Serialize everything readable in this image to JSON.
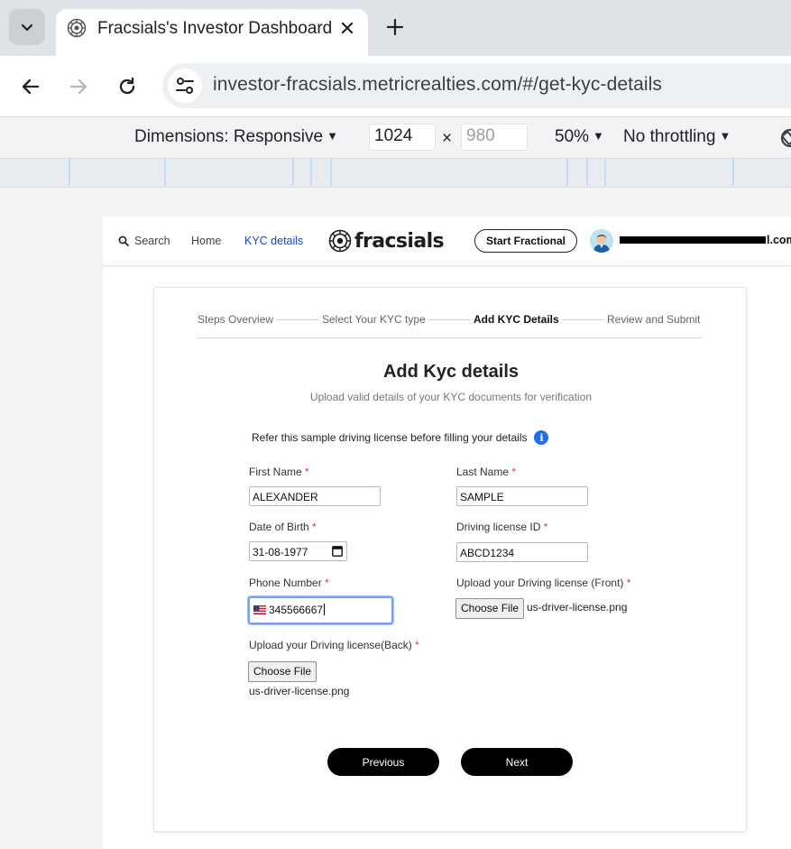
{
  "browser": {
    "tab_title": "Fracsials's Investor Dashboard",
    "url": "investor-fracsials.metricrealties.com/#/get-kyc-details"
  },
  "devtools": {
    "dimensions_label": "Dimensions: Responsive",
    "width": "1024",
    "height_placeholder": "980",
    "times": "×",
    "zoom": "50%",
    "throttling": "No throttling"
  },
  "site_header": {
    "search": "Search",
    "home": "Home",
    "kyc_details": "KYC details",
    "logo_text": "fracsials",
    "start_fractional": "Start Fractional",
    "email_suffix": "l.com"
  },
  "stepper": {
    "steps": [
      "Steps Overview",
      "Select Your KYC type",
      "Add KYC Details",
      "Review and Submit"
    ],
    "current_index": 2
  },
  "form": {
    "title": "Add Kyc details",
    "subtitle": "Upload valid details of your KYC documents for verification",
    "sample_note": "Refer this sample driving license before filling your details",
    "info_icon": "i",
    "required_mark": "*",
    "first_name_label": "First Name",
    "first_name_value": "ALEXANDER",
    "last_name_label": "Last Name",
    "last_name_value": "SAMPLE",
    "dob_label": "Date of Birth",
    "dob_value": "31-08-1977",
    "dl_id_label": "Driving license ID",
    "dl_id_value": "ABCD1234",
    "phone_label": "Phone Number",
    "phone_value": "345566667",
    "front_label": "Upload your Driving license (Front)",
    "front_button": "Choose File",
    "front_file": "us-driver-license.png",
    "back_label": "Upload your Driving license(Back)",
    "back_button": "Choose File",
    "back_file": "us-driver-license.png",
    "previous": "Previous",
    "next": "Next"
  },
  "colors": {
    "active_link": "#1a45c7",
    "required": "#e53935",
    "info": "#1e6ff0",
    "button": "#000000"
  }
}
